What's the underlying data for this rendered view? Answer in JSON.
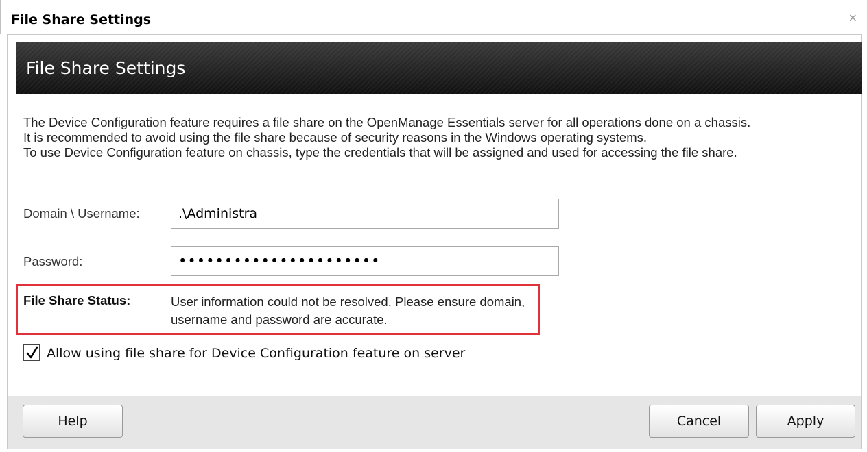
{
  "window": {
    "title": "File Share Settings",
    "close_glyph": "⨯"
  },
  "header": {
    "title": "File Share Settings"
  },
  "description": {
    "line1": "The Device Configuration feature requires a file share on the OpenManage Essentials server for all operations done on a chassis.",
    "line2": "It is recommended to avoid using the file share because of security reasons in the Windows operating systems.",
    "line3": "To use Device Configuration feature on chassis, type the credentials that will be assigned and used for accessing the file share."
  },
  "form": {
    "username_label": "Domain \\ Username:",
    "username_value": ".\\Administra",
    "password_label": "Password:",
    "password_value": "••••••••••••••••••••••"
  },
  "status": {
    "label": "File Share Status:",
    "message": "User information could not be resolved. Please ensure domain, username and password are accurate.",
    "highlight_color": "#e1313a"
  },
  "checkbox": {
    "checked": true,
    "label": "Allow using file share for Device Configuration feature on server"
  },
  "buttons": {
    "help": "Help",
    "cancel": "Cancel",
    "apply": "Apply"
  },
  "icons": {
    "close": "close-icon",
    "check": "checkmark-icon"
  }
}
